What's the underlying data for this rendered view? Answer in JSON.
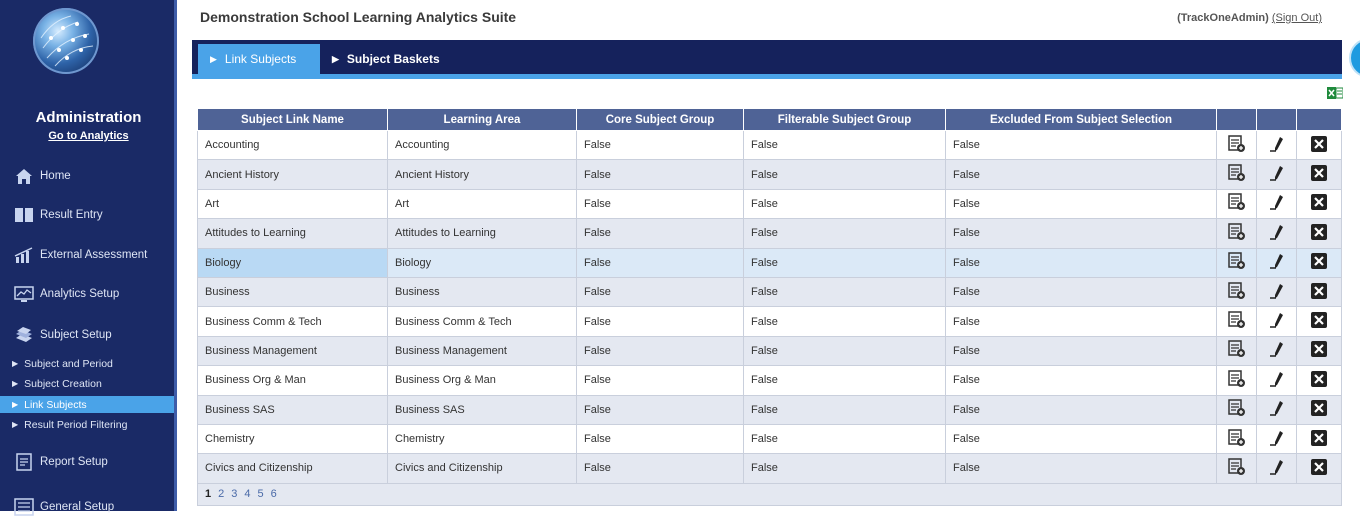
{
  "header": {
    "title": "Demonstration School Learning Analytics Suite",
    "user": "(TrackOneAdmin)",
    "sign_out": "(Sign Out)"
  },
  "sidebar": {
    "section_title": "Administration",
    "goto_link": "Go to Analytics",
    "items": [
      {
        "label": "Home",
        "icon": "home-icon"
      },
      {
        "label": "Result Entry",
        "icon": "book-icon"
      },
      {
        "label": "External Assessment",
        "icon": "bar-chart-icon"
      },
      {
        "label": "Analytics Setup",
        "icon": "monitor-chart-icon"
      },
      {
        "label": "Subject Setup",
        "icon": "books-stack-icon"
      },
      {
        "label": "Report Setup",
        "icon": "report-icon"
      },
      {
        "label": "General Setup",
        "icon": "list-icon"
      }
    ],
    "subitems": [
      {
        "label": "Subject and Period"
      },
      {
        "label": "Subject Creation"
      },
      {
        "label": "Link Subjects"
      },
      {
        "label": "Result Period Filtering"
      }
    ]
  },
  "tabs": [
    {
      "label": "Link Subjects"
    },
    {
      "label": "Subject Baskets"
    }
  ],
  "table": {
    "columns": [
      "Subject Link Name",
      "Learning Area",
      "Core Subject Group",
      "Filterable Subject Group",
      "Excluded From Subject Selection",
      "",
      "",
      ""
    ],
    "rows": [
      [
        "Accounting",
        "Accounting",
        "False",
        "False",
        "False"
      ],
      [
        "Ancient History",
        "Ancient History",
        "False",
        "False",
        "False"
      ],
      [
        "Art",
        "Art",
        "False",
        "False",
        "False"
      ],
      [
        "Attitudes to Learning",
        "Attitudes to Learning",
        "False",
        "False",
        "False"
      ],
      [
        "Biology",
        "Biology",
        "False",
        "False",
        "False"
      ],
      [
        "Business",
        "Business",
        "False",
        "False",
        "False"
      ],
      [
        "Business Comm & Tech",
        "Business Comm & Tech",
        "False",
        "False",
        "False"
      ],
      [
        "Business Management",
        "Business Management",
        "False",
        "False",
        "False"
      ],
      [
        "Business Org & Man",
        "Business Org & Man",
        "False",
        "False",
        "False"
      ],
      [
        "Business SAS",
        "Business SAS",
        "False",
        "False",
        "False"
      ],
      [
        "Chemistry",
        "Chemistry",
        "False",
        "False",
        "False"
      ],
      [
        "Civics and Citizenship",
        "Civics and Citizenship",
        "False",
        "False",
        "False"
      ]
    ],
    "pages": [
      "1",
      "2",
      "3",
      "4",
      "5",
      "6"
    ],
    "current_page": "1"
  },
  "colors": {
    "sidebar_bg": "#1a2a66",
    "tabbar_bg": "#15225c",
    "accent": "#4aa3e8",
    "table_header": "#4f6396"
  }
}
